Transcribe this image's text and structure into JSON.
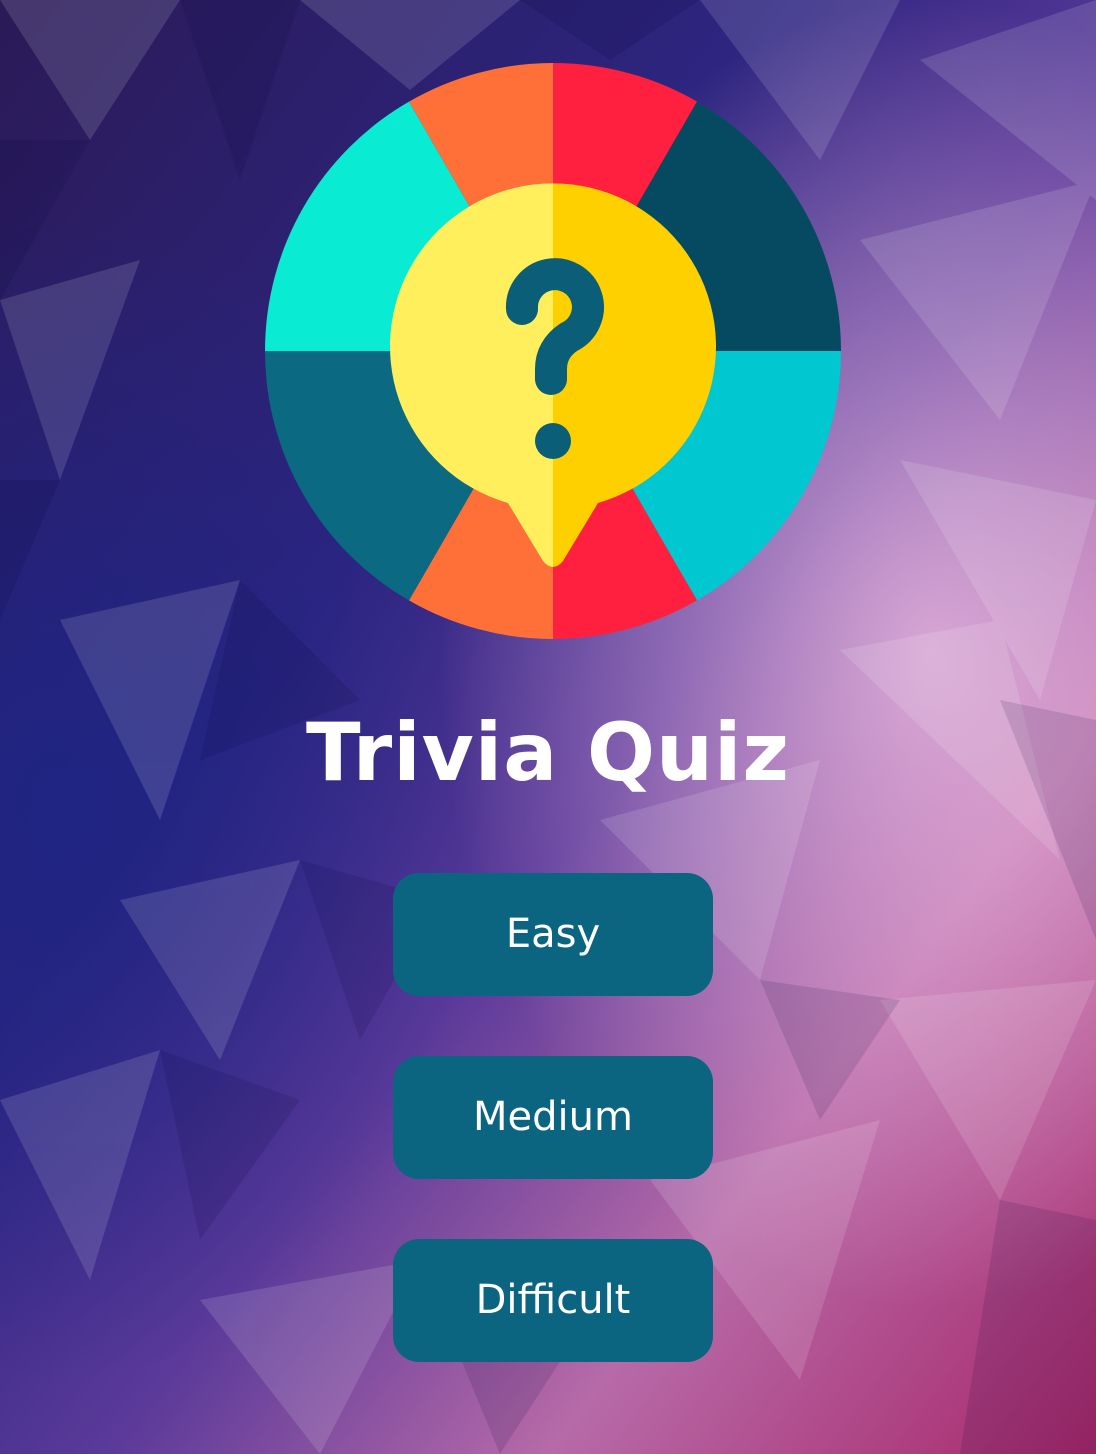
{
  "app": {
    "title": "Trivia Quiz"
  },
  "logo": {
    "icon": "question-mark-wheel-icon"
  },
  "difficulty_buttons": [
    {
      "label": "Easy"
    },
    {
      "label": "Medium"
    },
    {
      "label": "Difficult"
    }
  ],
  "colors": {
    "button_bg": "#0b6580",
    "title_text": "#ffffff",
    "wheel_teal": "#0aebd3",
    "wheel_orange": "#ff7038",
    "wheel_red": "#ff1f3f",
    "wheel_navy": "#064a62",
    "wheel_dark_teal": "#0b6a82",
    "wheel_cyan": "#00c7d0",
    "bubble_left": "#ffef5c",
    "bubble_right": "#ffd000",
    "question_mark": "#0a5e78"
  }
}
